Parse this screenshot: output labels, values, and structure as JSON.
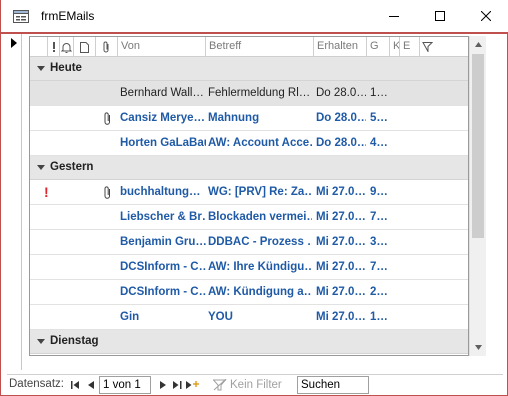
{
  "window": {
    "title": "frmEMails"
  },
  "columns": {
    "von": "Von",
    "betreff": "Betreff",
    "erhalten": "Erhalten",
    "groesse": "G",
    "k": "K",
    "e": "E"
  },
  "groups": [
    {
      "label": "Heute",
      "rows": [
        {
          "importance": "",
          "attachment": false,
          "unread": false,
          "selected": true,
          "von": "Bernhard Wall…",
          "betreff": "Fehlermeldung Rl…",
          "erhalten": "Do 28.0…",
          "groesse": "1…"
        },
        {
          "importance": "",
          "attachment": true,
          "unread": true,
          "selected": false,
          "von": "Cansiz Merye…",
          "betreff": "Mahnung",
          "erhalten": "Do 28.0…",
          "groesse": "5…"
        },
        {
          "importance": "",
          "attachment": false,
          "unread": true,
          "selected": false,
          "von": "Horten GaLaBau",
          "betreff": "AW: Account Acce…",
          "erhalten": "Do 28.0…",
          "groesse": "4…"
        }
      ]
    },
    {
      "label": "Gestern",
      "rows": [
        {
          "importance": "!",
          "attachment": true,
          "unread": true,
          "selected": false,
          "von": "buchhaltung…",
          "betreff": "WG: [PRV] Re: Za…",
          "erhalten": "Mi 27.0…",
          "groesse": "9…"
        },
        {
          "importance": "",
          "attachment": false,
          "unread": true,
          "selected": false,
          "von": "Liebscher & Br…",
          "betreff": "Blockaden vermei…",
          "erhalten": "Mi 27.0…",
          "groesse": "7…"
        },
        {
          "importance": "",
          "attachment": false,
          "unread": true,
          "selected": false,
          "von": "Benjamin Gru…",
          "betreff": "DDBAC - Prozess …",
          "erhalten": "Mi 27.0…",
          "groesse": "3…"
        },
        {
          "importance": "",
          "attachment": false,
          "unread": true,
          "selected": false,
          "von": "DCSInform - C…",
          "betreff": "AW: Ihre Kündigu…",
          "erhalten": "Mi 27.0…",
          "groesse": "7…"
        },
        {
          "importance": "",
          "attachment": false,
          "unread": true,
          "selected": false,
          "von": "DCSInform - C…",
          "betreff": "AW: Kündigung a…",
          "erhalten": "Mi 27.0…",
          "groesse": "2…"
        },
        {
          "importance": "",
          "attachment": false,
          "unread": true,
          "selected": false,
          "von": "Gin",
          "betreff": "YOU",
          "erhalten": "Mi 27.0…",
          "groesse": "1…"
        }
      ]
    },
    {
      "label": "Dienstag",
      "rows": []
    }
  ],
  "navbar": {
    "label": "Datensatz:",
    "record": "1 von 1",
    "filter": "Kein Filter",
    "search": "Suchen"
  },
  "colors": {
    "accent": "#c0504d",
    "unread_text": "#1f5aa6",
    "importance": "#e0242c",
    "group_bg": "#e6e6e6"
  }
}
